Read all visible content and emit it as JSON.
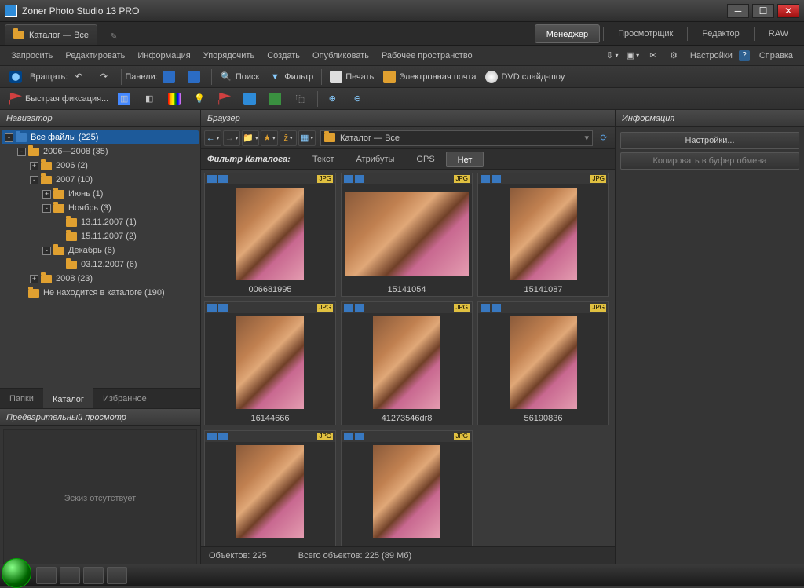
{
  "app": {
    "title": "Zoner Photo Studio 13 PRO"
  },
  "topTab": {
    "label": "Каталог — Все"
  },
  "modes": {
    "manager": "Менеджер",
    "viewer": "Просмотрщик",
    "editor": "Редактор",
    "raw": "RAW"
  },
  "menu": {
    "request": "Запросить",
    "edit": "Редактировать",
    "info": "Информация",
    "arrange": "Упорядочить",
    "create": "Создать",
    "publish": "Опубликовать",
    "workspace": "Рабочее пространство",
    "settings": "Настройки",
    "help": "Справка"
  },
  "toolbar1": {
    "rotate": "Вращать:",
    "panels": "Панели:",
    "search": "Поиск",
    "filter": "Фильтр",
    "print": "Печать",
    "email": "Электронная почта",
    "dvd": "DVD слайд-шоу"
  },
  "toolbar2": {
    "quick": "Быстрая фиксация..."
  },
  "nav": {
    "title": "Навигатор",
    "tabs": {
      "folders": "Папки",
      "catalog": "Каталог",
      "favorites": "Избранное"
    },
    "tree": [
      {
        "depth": 0,
        "tw": "-",
        "label": "Все файлы (225)",
        "sel": true,
        "blue": true
      },
      {
        "depth": 1,
        "tw": "-",
        "label": "2006—2008 (35)"
      },
      {
        "depth": 2,
        "tw": "+",
        "label": "2006 (2)"
      },
      {
        "depth": 2,
        "tw": "-",
        "label": "2007 (10)"
      },
      {
        "depth": 3,
        "tw": "+",
        "label": "Июнь (1)"
      },
      {
        "depth": 3,
        "tw": "-",
        "label": "Ноябрь (3)"
      },
      {
        "depth": 4,
        "tw": "",
        "label": "13.11.2007 (1)"
      },
      {
        "depth": 4,
        "tw": "",
        "label": "15.11.2007 (2)"
      },
      {
        "depth": 3,
        "tw": "-",
        "label": "Декабрь (6)"
      },
      {
        "depth": 4,
        "tw": "",
        "label": "03.12.2007 (6)"
      },
      {
        "depth": 2,
        "tw": "+",
        "label": "2008 (23)"
      },
      {
        "depth": 1,
        "tw": "",
        "label": "Не находится в каталоге (190)"
      }
    ]
  },
  "preview": {
    "title": "Предварительный просмотр",
    "empty": "Эскиз отсутствует"
  },
  "browser": {
    "title": "Браузер",
    "path": "Каталог — Все",
    "filterLabel": "Фильтр Каталога:",
    "filters": {
      "text": "Текст",
      "attrs": "Атрибуты",
      "gps": "GPS",
      "none": "Нет"
    },
    "thumbs": [
      {
        "name": "006681995",
        "o": "tall"
      },
      {
        "name": "15141054",
        "o": "wide"
      },
      {
        "name": "15141087",
        "o": "tall"
      },
      {
        "name": "16144666",
        "o": "tall"
      },
      {
        "name": "41273546dr8",
        "o": "tall"
      },
      {
        "name": "56190836",
        "o": "tall"
      },
      {
        "name": "",
        "o": "tall"
      },
      {
        "name": "",
        "o": "tall"
      }
    ],
    "badge": "JPG",
    "status": {
      "count": "Объектов: 225",
      "total": "Всего объектов: 225 (89 Мб)"
    }
  },
  "info": {
    "title": "Информация",
    "settings": "Настройки...",
    "copy": "Копировать в буфер обмена"
  }
}
